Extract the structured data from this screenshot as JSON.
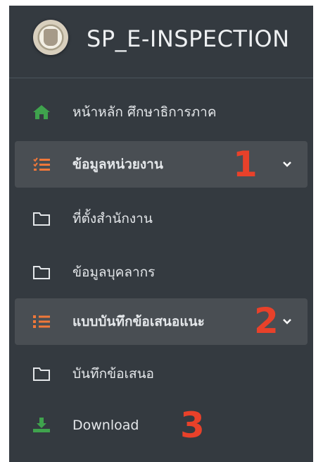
{
  "brand": {
    "title": "SP_E-INSPECTION"
  },
  "nav": {
    "home_label": "หน้าหลัก ศึกษาธิการภาค",
    "agency_label": "ข้อมูลหน่วยงาน",
    "office_label": "ที่ตั้งสำนักงาน",
    "personnel_label": "ข้อมูลบุคลากร",
    "form_label": "แบบบันทึกข้อเสนอแนะ",
    "record_label": "บันทึกข้อเสนอ",
    "download_label": "Download"
  },
  "annotations": {
    "one": "1",
    "two": "2",
    "three": "3"
  },
  "colors": {
    "sidebar_bg": "#343a40",
    "active_bg": "#494e53",
    "home_icon": "#3fa34d",
    "list_icon": "#f0783a",
    "download_icon": "#3fa34d",
    "annotation": "#e8412a"
  },
  "icons": {
    "home": "home-icon",
    "agency": "list-check-icon",
    "office": "folder-icon",
    "personnel": "folder-icon",
    "form": "list-icon",
    "record": "folder-icon",
    "download": "download-icon",
    "expand": "chevron-down-icon"
  }
}
